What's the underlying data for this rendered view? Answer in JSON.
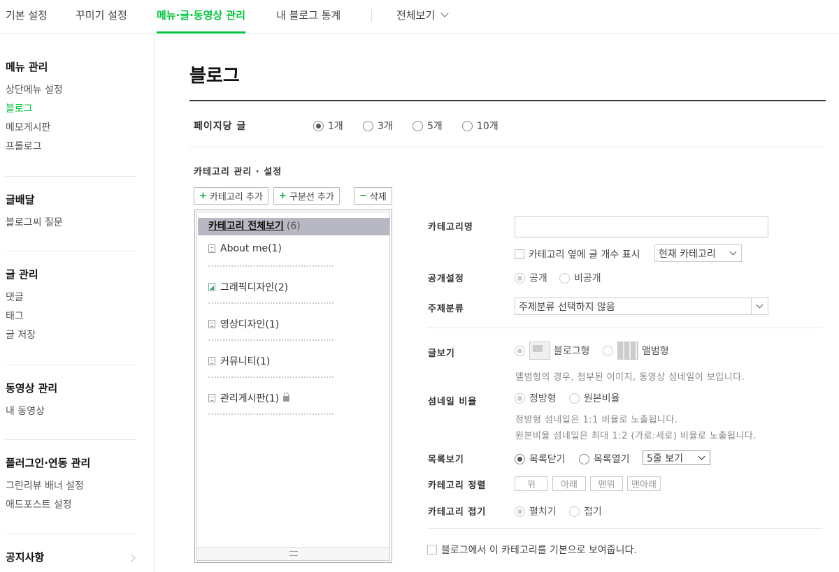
{
  "topnav": {
    "tabs": [
      "기본 설정",
      "꾸미기 설정",
      "메뉴·글·동영상 관리",
      "내 블로그 통계",
      "전체보기"
    ]
  },
  "sidebar": {
    "groups": [
      {
        "title": "메뉴 관리",
        "items": [
          "상단메뉴 설정",
          "블로그",
          "메모게시판",
          "프롤로그"
        ]
      },
      {
        "title": "글배달",
        "items": [
          "블로그씨 질문"
        ]
      },
      {
        "title": "글 관리",
        "items": [
          "댓글",
          "태그",
          "글 저장"
        ]
      },
      {
        "title": "동영상 관리",
        "items": [
          "내 동영상"
        ]
      },
      {
        "title": "플러그인·연동 관리",
        "items": [
          "그린리뷰 배너 설정",
          "애드포스트 설정"
        ]
      },
      {
        "title": "공지사항",
        "items": []
      }
    ]
  },
  "main": {
    "title": "블로그",
    "per_page": {
      "label": "페이지당 글",
      "options": [
        "1개",
        "3개",
        "5개",
        "10개"
      ],
      "selected": "1개"
    },
    "category_section": {
      "label": "카테고리 관리 · 설정",
      "buttons": {
        "add_category": "카테고리 추가",
        "add_divider": "구분선 추가",
        "delete": "삭제"
      },
      "all": {
        "label": "카테고리 전체보기",
        "count": "(6)"
      },
      "items": [
        "About me(1)",
        "그래픽디자인(2)",
        "영상디자인(1)",
        "커뮤니티(1)",
        "관리게시판(1)"
      ]
    },
    "settings": {
      "name_label": "카테고리명",
      "name_value": "",
      "show_count_label": "카테고리 옆에 글 개수 표시",
      "count_scope_select": "현재 카테고리",
      "visibility": {
        "label": "공개설정",
        "options": [
          "공개",
          "비공개"
        ],
        "selected": "공개"
      },
      "topic": {
        "label": "주제분류",
        "value": "주제분류 선택하지 않음"
      },
      "view": {
        "label": "글보기",
        "options": [
          "블로그형",
          "앨범형"
        ],
        "selected": "블로그형",
        "help": "앨범형의 경우, 첨부된 이미지, 동영상 섬네일이 보입니다."
      },
      "thumb_ratio": {
        "label": "섬네일 비율",
        "options": [
          "정방형",
          "원본비율"
        ],
        "selected": "정방형",
        "help1": "정방형 섬네일은 1:1 비율로 노출됩니다.",
        "help2": "원본비율 섬네일은 최대 1:2 (가로:세로) 비율로 노출됩니다."
      },
      "list_view": {
        "label": "목록보기",
        "options": [
          "목록닫기",
          "목록열기"
        ],
        "selected": "목록닫기",
        "lines": "5줄 보기"
      },
      "sort": {
        "label": "카테고리 정렬",
        "buttons": [
          "위",
          "아래",
          "맨위",
          "맨아래"
        ]
      },
      "fold": {
        "label": "카테고리 접기",
        "options": [
          "펼치기",
          "접기"
        ],
        "selected": "펼치기"
      },
      "default_label": "블로그에서 이 카테고리를 기본으로 보여줍니다."
    }
  }
}
